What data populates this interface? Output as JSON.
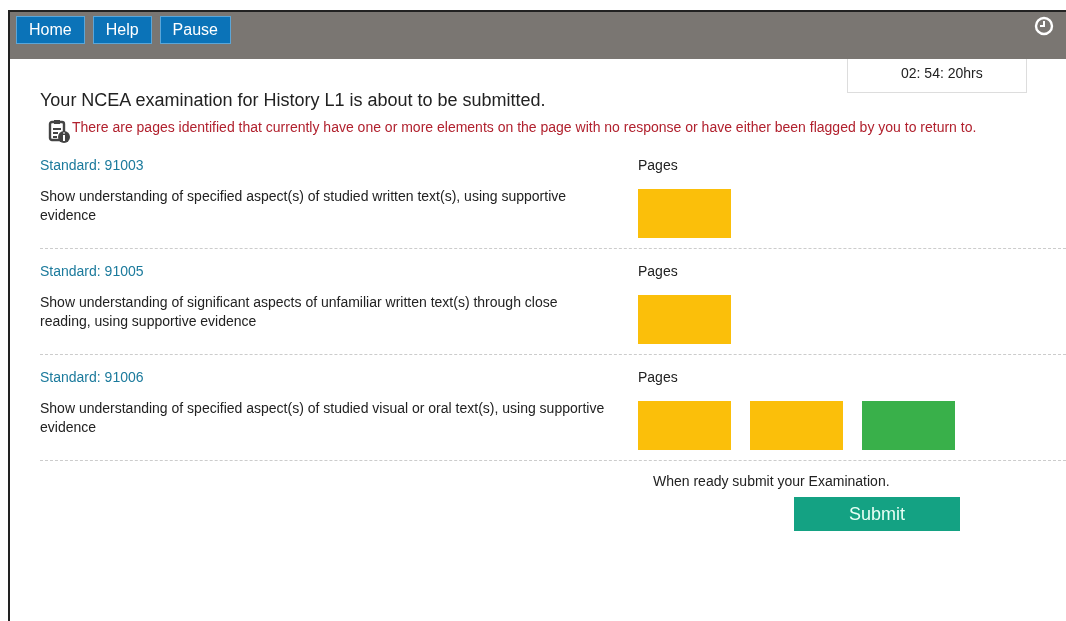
{
  "toolbar": {
    "buttons": [
      "Home",
      "Help",
      "Pause"
    ]
  },
  "timer": "02: 54: 20hrs",
  "title": "Your NCEA examination for History L1 is about to be submitted.",
  "warning": "There are pages identified that currently have one or more elements on the page with no response or have either been flagged by you to return to.",
  "standards": [
    {
      "label": "Standard: 91003",
      "description": "Show understanding of specified aspect(s) of studied written text(s), using supportive evidence",
      "pages_label": "Pages",
      "pages": [
        {
          "color": "#fbbf0a"
        }
      ]
    },
    {
      "label": "Standard: 91005",
      "description": "Show understanding of significant aspects of unfamiliar written text(s) through close reading, using supportive evidence",
      "pages_label": "Pages",
      "pages": [
        {
          "color": "#fbbf0a"
        }
      ]
    },
    {
      "label": "Standard: 91006",
      "description": "Show understanding of specified aspect(s) of studied visual or oral text(s), using supportive evidence",
      "pages_label": "Pages",
      "pages": [
        {
          "color": "#fbbf0a"
        },
        {
          "color": "#fbbf0a"
        },
        {
          "color": "#39b04a"
        }
      ]
    }
  ],
  "submit_prompt": "When ready submit your Examination.",
  "submit_button": "Submit"
}
